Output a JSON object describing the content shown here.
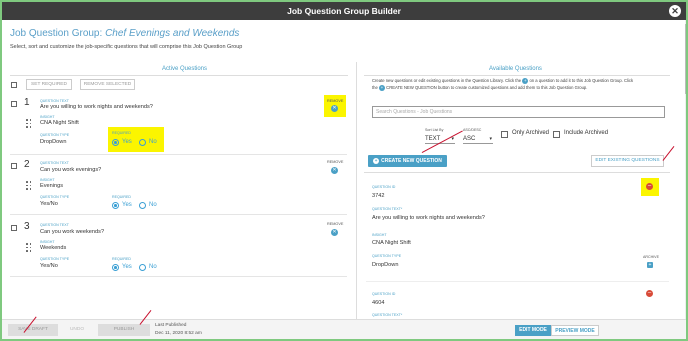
{
  "window": {
    "title": "Job Question Group Builder"
  },
  "heading": {
    "prefix": "Job Question Group: ",
    "group_name": "Chef Evenings and Weekends"
  },
  "subheading": "Select, sort and customize the job-specific questions that will comprise this Job Question Group",
  "active": {
    "title": "Active Questions",
    "set_required": "SET REQUIRED",
    "remove_selected": "REMOVE SELECTED",
    "labels": {
      "question_text": "QUESTION TEXT",
      "insight": "INSIGHT",
      "question_type": "QUESTION TYPE",
      "required": "REQUIRED",
      "remove": "REMOVE",
      "yes": "Yes",
      "no": "No"
    },
    "questions": [
      {
        "number": "1",
        "text": "Are you willing to work nights and weekends?",
        "insight": "CNA Night Shift",
        "type": "DropDown",
        "required": "Yes"
      },
      {
        "number": "2",
        "text": "Can you work evenings?",
        "insight": "Evenings",
        "type": "Yes/No",
        "required": "Yes"
      },
      {
        "number": "3",
        "text": "Can you work weekends?",
        "insight": "Weekends",
        "type": "Yes/No",
        "required": "Yes"
      }
    ]
  },
  "available": {
    "title": "Available Questions",
    "info_line1": "Create new questions or edit existing questions in the Question Library. Click the",
    "info_line1b": "on a question to add it to this Job Question Group. Click",
    "info_line2a": "the",
    "info_line2b": "CREATE NEW QUESTION button to create customized questions and add them to this Job Question Group.",
    "search_placeholder": "Search Questions - Job Questions",
    "sort_label": "Sort List By",
    "sort_value": "TEXT",
    "order_label": "ASC/DESC",
    "order_value": "ASC",
    "only_archived": "Only Archived",
    "include_archived": "Include Archived",
    "create_button": "CREATE NEW QUESTION",
    "edit_button": "EDIT EXISTING QUESTIONS",
    "labels": {
      "question_id": "QUESTION ID",
      "question_text": "QUESTION TEXT*",
      "insight": "INSIGHT",
      "question_type": "QUESTION TYPE",
      "archive": "ARCHIVE"
    },
    "questions": [
      {
        "id": "3742",
        "text": "Are you willing to work nights and weekends?",
        "insight": "CNA Night Shift",
        "type": "DropDown"
      },
      {
        "id": "4604"
      }
    ]
  },
  "footer": {
    "save_draft": "SAVE DRAFT",
    "undo": "UNDO",
    "publish": "PUBLISH",
    "last_published_label": "Last Published",
    "last_published_value": "Dec 11, 2020 8:52 am",
    "edit_mode": "EDIT MODE",
    "preview_mode": "PREVIEW MODE"
  },
  "colors": {
    "accent": "#4aa0c6",
    "titlebar": "#3d3d3d",
    "highlight": "#fbf500",
    "danger": "#d84a38",
    "annotation": "#c8102e",
    "frame": "#7fc97f"
  }
}
